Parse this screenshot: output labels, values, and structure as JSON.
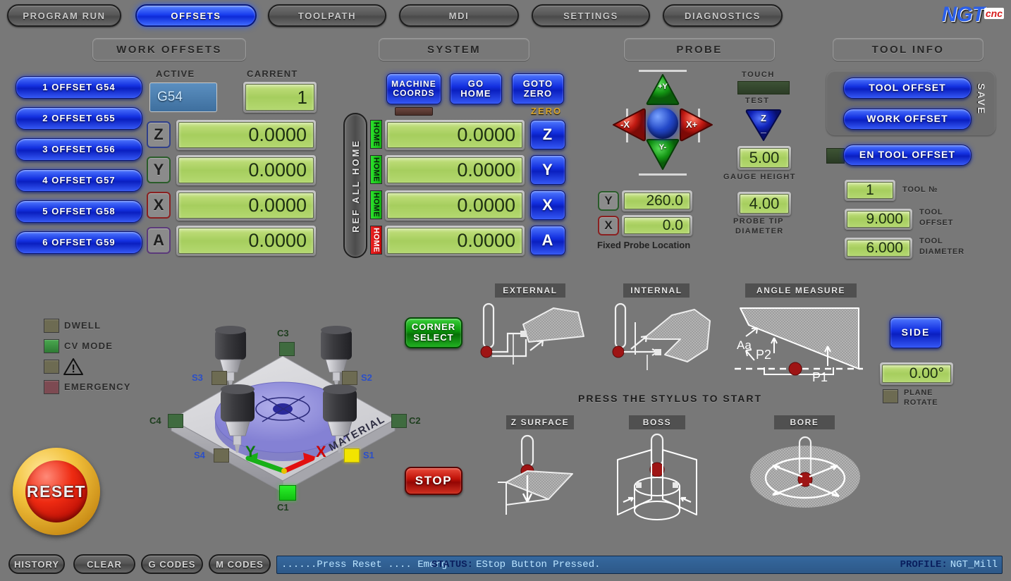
{
  "app": {
    "logo_main": "NGT",
    "logo_sub": "cnc"
  },
  "tabs": [
    {
      "label": "PROGRAM RUN",
      "active": false
    },
    {
      "label": "OFFSETS",
      "active": true
    },
    {
      "label": "TOOLPATH",
      "active": false
    },
    {
      "label": "MDI",
      "active": false
    },
    {
      "label": "SETTINGS",
      "active": false
    },
    {
      "label": "DIAGNOSTICS",
      "active": false
    }
  ],
  "sections": {
    "work_offsets": "WORK OFFSETS",
    "system": "SYSTEM",
    "probe": "PROBE",
    "tool_info": "TOOL INFO"
  },
  "work_offsets": {
    "buttons": [
      "1 OFFSET G54",
      "2 OFFSET G55",
      "3 OFFSET G56",
      "4 OFFSET G57",
      "5 OFFSET G58",
      "6 OFFSET G59"
    ],
    "active_label": "ACTIVE",
    "active_value": "G54",
    "current_label": "CARRENT",
    "current_value": "1",
    "axes": [
      {
        "axis": "Z",
        "value": "0.0000"
      },
      {
        "axis": "Y",
        "value": "0.0000"
      },
      {
        "axis": "X",
        "value": "0.0000"
      },
      {
        "axis": "A",
        "value": "0.0000"
      }
    ]
  },
  "system": {
    "machine_coords": "MACHINE\nCOORDS",
    "machine_coords_l1": "MACHINE",
    "machine_coords_l2": "COORDS",
    "go_home_l1": "GO",
    "go_home_l2": "HOME",
    "goto_zero_l1": "GOTO",
    "goto_zero_l2": "ZERO",
    "zero_label": "ZERO",
    "ref_all_home": "REF ALL HOME",
    "rows": [
      {
        "home": "HOME",
        "homed": true,
        "value": "0.0000",
        "zero_axis": "Z"
      },
      {
        "home": "HOME",
        "homed": true,
        "value": "0.0000",
        "zero_axis": "Y"
      },
      {
        "home": "HOME",
        "homed": true,
        "value": "0.0000",
        "zero_axis": "X"
      },
      {
        "home": "HOME",
        "homed": false,
        "value": "0.0000",
        "zero_axis": "A"
      }
    ]
  },
  "probe": {
    "jog": {
      "up": "+Y",
      "left": "-X",
      "right": "X+",
      "down": "Y-"
    },
    "touch_label": "TOUCH",
    "test_label": "TEST",
    "test_axis": "Z",
    "gauge_height_value": "5.00",
    "gauge_height_label": "GAUGE HEIGHT",
    "probe_tip_value": "4.00",
    "probe_tip_label_l1": "PROBE TIP",
    "probe_tip_label_l2": "DIAMETER",
    "fixed_label": "Fixed Probe Location",
    "fixed": [
      {
        "axis": "Y",
        "value": "260.0"
      },
      {
        "axis": "X",
        "value": "0.0"
      }
    ]
  },
  "tool_info": {
    "tool_offset_btn": "TOOL OFFSET",
    "work_offset_btn": "WORK OFFSET",
    "save_label": "SAVE",
    "en_tool_offset_btn": "EN TOOL OFFSET",
    "fields": [
      {
        "value": "1",
        "label_l1": "TOOL №",
        "label_l2": ""
      },
      {
        "value": "9.000",
        "label_l1": "TOOL",
        "label_l2": "OFFSET"
      },
      {
        "value": "6.000",
        "label_l1": "TOOL",
        "label_l2": "DIAMETER"
      }
    ]
  },
  "indicators": [
    {
      "label": "DWELL",
      "color": "#6d6b52",
      "on": false
    },
    {
      "label": "CV MODE",
      "color": "#3e9546",
      "on": true
    },
    {
      "label": "",
      "color": "#6d6b52",
      "on": false,
      "icon": "warning-triangle"
    },
    {
      "label": "EMERGENCY",
      "color": "#7d4a52",
      "on": false
    }
  ],
  "machine_diagram": {
    "material_label": "MATERIAL",
    "axis_x": "X",
    "axis_y": "Y",
    "corners": [
      {
        "id": "C1",
        "active": true
      },
      {
        "id": "C2",
        "active": false
      },
      {
        "id": "C3",
        "active": false
      },
      {
        "id": "C4",
        "active": false
      }
    ],
    "sides": [
      {
        "id": "S1",
        "active": true
      },
      {
        "id": "S2",
        "active": false
      },
      {
        "id": "S3",
        "active": false
      },
      {
        "id": "S4",
        "active": false
      }
    ]
  },
  "actions": {
    "corner_select_l1": "CORNER",
    "corner_select_l2": "SELECT",
    "stop": "STOP",
    "side": "SIDE"
  },
  "probe_modes": {
    "top": [
      {
        "id": "external",
        "caption": "EXTERNAL"
      },
      {
        "id": "internal",
        "caption": "INTERNAL"
      },
      {
        "id": "angle-measure",
        "caption": "ANGLE MEASURE"
      }
    ],
    "bottom": [
      {
        "id": "z-surface",
        "caption": "Z SURFACE"
      },
      {
        "id": "boss",
        "caption": "BOSS"
      },
      {
        "id": "bore",
        "caption": "BORE"
      }
    ],
    "hint": "PRESS THE STYLUS TO START",
    "angle_labels": {
      "aa": "Aa",
      "p1": "P1",
      "p2": "P2"
    }
  },
  "plane": {
    "angle_value": "0.00°",
    "rotate_l1": "PLANE",
    "rotate_l2": "ROTATE"
  },
  "reset": {
    "label": "RESET"
  },
  "bottom_bar": {
    "buttons": [
      "HISTORY",
      "CLEAR",
      "G CODES",
      "M CODES"
    ],
    "message": "......Press Reset .... Emerg",
    "status_key": "STATUS:",
    "status_value": "EStop Button Pressed.",
    "profile_key": "PROFILE:",
    "profile_value": "NGT_Mill"
  },
  "colors": {
    "accent_blue": "#1330e0",
    "lcd_green": "#a9d063",
    "alarm_red": "#c01208",
    "ok_green": "#12b012",
    "bg": "#787878"
  }
}
